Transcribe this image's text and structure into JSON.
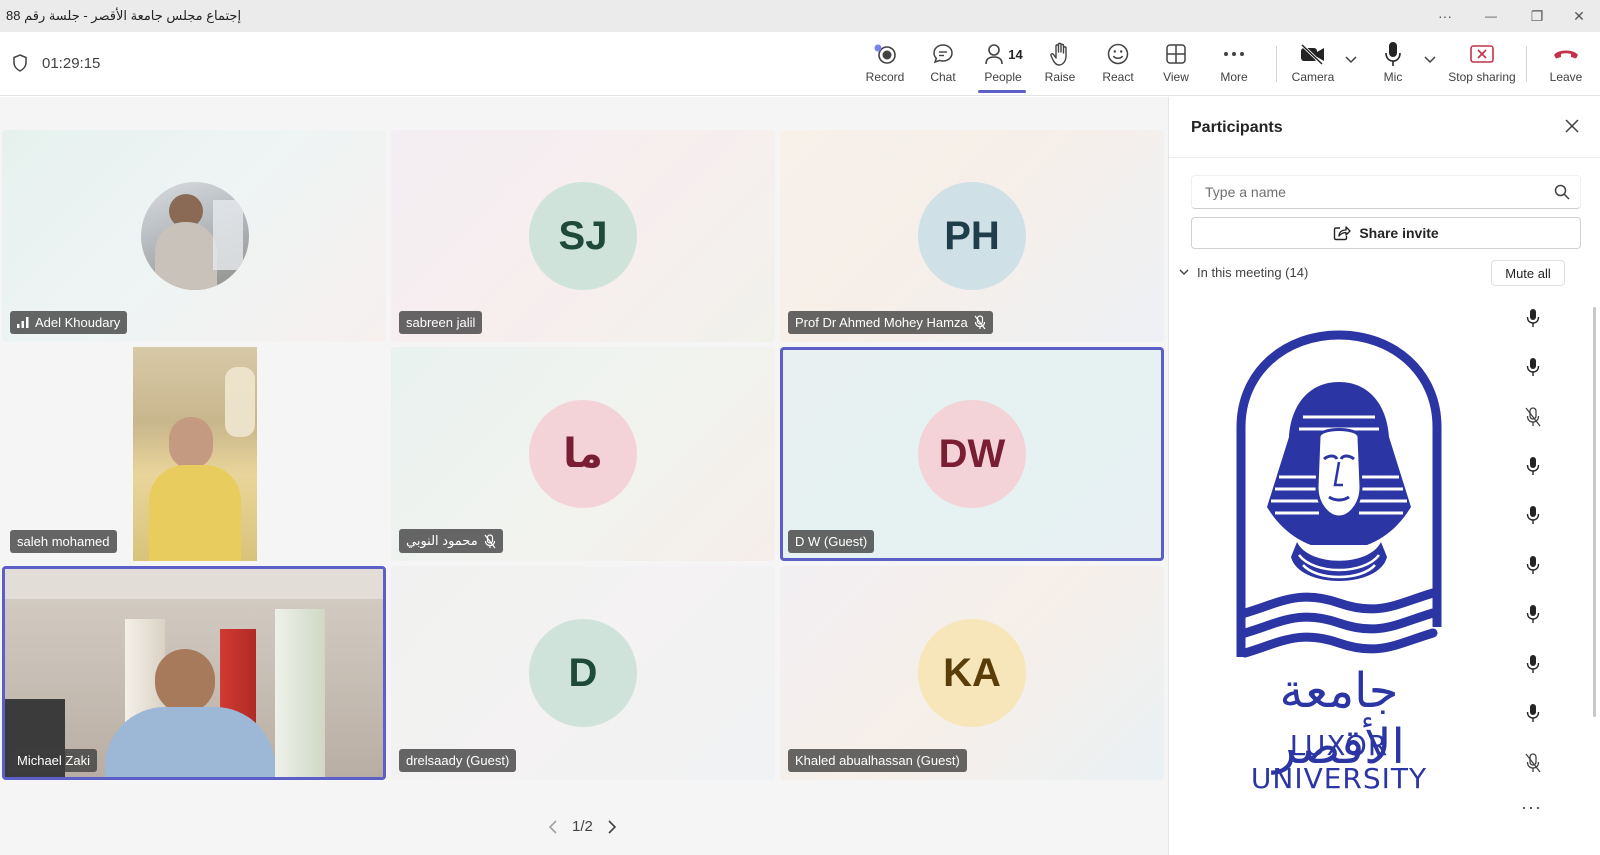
{
  "window": {
    "title": "إجتماع مجلس جامعة الأقصر - جلسة رقم 88",
    "more_label": "···",
    "minimize_label": "—",
    "restore_label": "❐",
    "close_label": "✕"
  },
  "toolbar": {
    "timer": "01:29:15",
    "record": "Record",
    "chat": "Chat",
    "people": "People",
    "people_count": "14",
    "raise": "Raise",
    "react": "React",
    "view": "View",
    "more": "More",
    "camera": "Camera",
    "mic": "Mic",
    "stop_sharing": "Stop sharing",
    "leave": "Leave"
  },
  "tiles": [
    {
      "name": "Adel Khoudary",
      "type": "photo"
    },
    {
      "name": "sabreen jalil",
      "initials": "SJ",
      "avatar_bg": "#cfe3da",
      "avatar_fg": "#1f4a3b"
    },
    {
      "name": "Prof Dr Ahmed Mohey Hamza",
      "initials": "PH",
      "avatar_bg": "#cfe0e6",
      "avatar_fg": "#1f3e4a",
      "muted": true
    },
    {
      "name": "saleh mohamed",
      "type": "video"
    },
    {
      "name": "محمود النوبي",
      "initials": "ما",
      "avatar_bg": "#f3d3d8",
      "avatar_fg": "#7a1f33",
      "muted": true
    },
    {
      "name": "D W (Guest)",
      "initials": "DW",
      "avatar_bg": "#f3d3d8",
      "avatar_fg": "#7a1f33"
    },
    {
      "name": "Michael Zaki",
      "type": "video"
    },
    {
      "name": "drelsaady (Guest)",
      "initials": "D",
      "avatar_bg": "#cfe3da",
      "avatar_fg": "#1f4a3b"
    },
    {
      "name": "Khaled abualhassan (Guest)",
      "initials": "KA",
      "avatar_bg": "#f6e6b9",
      "avatar_fg": "#5a3e0a"
    }
  ],
  "pager": {
    "label": "1/2"
  },
  "panel": {
    "title": "Participants",
    "search_placeholder": "Type a name",
    "share_invite": "Share invite",
    "in_meeting": "In this meeting (14)",
    "mute_all": "Mute all",
    "mic_states": [
      "on",
      "on",
      "off",
      "on",
      "on",
      "on",
      "on",
      "on",
      "on",
      "off"
    ],
    "logo_arabic": "جامعة الأقصر",
    "logo_english": "LUXOR UNIVERSITY"
  },
  "colors": {
    "accent": "#5b5fc7",
    "leave_red": "#c4314b",
    "logo_blue": "#2b35a3"
  }
}
